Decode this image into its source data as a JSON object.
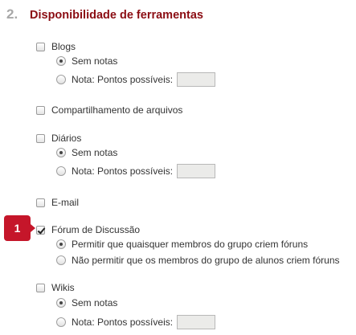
{
  "section": {
    "number": "2.",
    "title": "Disponibilidade de ferramentas"
  },
  "callout": "1",
  "tools": [
    {
      "label": "Blogs",
      "checked": false,
      "options": [
        {
          "label": "Sem notas",
          "selected": true
        },
        {
          "label": "Nota: Pontos possíveis:",
          "selected": false,
          "input_value": ""
        }
      ]
    },
    {
      "label": "Compartilhamento de arquivos",
      "checked": false,
      "options": []
    },
    {
      "label": "Diários",
      "checked": false,
      "options": [
        {
          "label": "Sem notas",
          "selected": true
        },
        {
          "label": "Nota: Pontos possíveis:",
          "selected": false,
          "input_value": ""
        }
      ]
    },
    {
      "label": "E-mail",
      "checked": false,
      "options": []
    },
    {
      "label": "Fórum de Discussão",
      "checked": true,
      "options": [
        {
          "label": "Permitir que quaisquer membros do grupo criem fóruns",
          "selected": true
        },
        {
          "label": "Não permitir que os membros do grupo de alunos criem fóruns",
          "selected": false
        }
      ]
    },
    {
      "label": "Wikis",
      "checked": false,
      "options": [
        {
          "label": "Sem notas",
          "selected": true
        },
        {
          "label": "Nota: Pontos possíveis:",
          "selected": false,
          "input_value": ""
        }
      ]
    }
  ]
}
